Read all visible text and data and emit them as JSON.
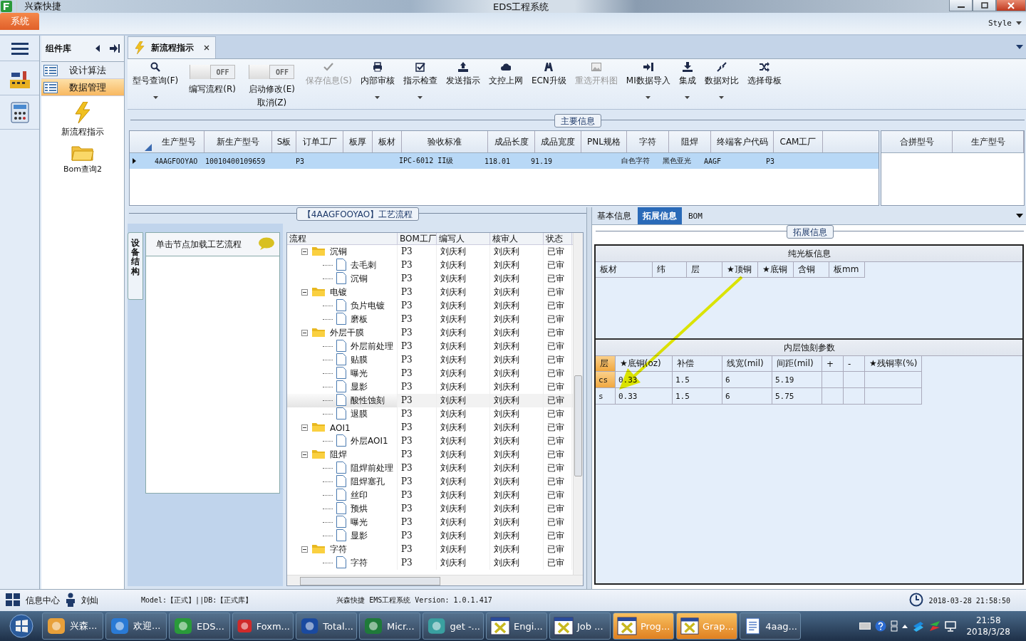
{
  "window": {
    "app_name": "兴森快捷",
    "title": "EDS工程系统"
  },
  "ribbon": {
    "tabs": [
      {
        "label": "系统",
        "selected": true
      }
    ],
    "style_menu": "Style"
  },
  "component_panel": {
    "title": "组件库",
    "items": [
      {
        "label": "设计算法",
        "selected": false
      },
      {
        "label": "数据管理",
        "selected": true
      }
    ],
    "tools": [
      {
        "label": "新流程指示"
      },
      {
        "label": "Bom查询2"
      }
    ]
  },
  "doc_tabs": [
    {
      "label": "新流程指示",
      "selected": true
    }
  ],
  "toolbar": [
    {
      "kind": "button",
      "lines": [
        "型号查询(F)"
      ],
      "disabled": false,
      "dropdown": true
    },
    {
      "kind": "toggle",
      "lines": [
        "编写流程(R)"
      ],
      "on": false,
      "state_text": "OFF"
    },
    {
      "kind": "toggle",
      "lines": [
        "启动修改(E)",
        "取消(Z)"
      ],
      "on": false,
      "state_text": "OFF"
    },
    {
      "kind": "button",
      "lines": [
        "保存信息(S)"
      ],
      "disabled": true,
      "dropdown": false
    },
    {
      "kind": "button",
      "lines": [
        "内部审核"
      ],
      "disabled": false,
      "dropdown": true
    },
    {
      "kind": "button",
      "lines": [
        "指示检查"
      ],
      "disabled": false,
      "dropdown": true
    },
    {
      "kind": "button",
      "lines": [
        "发送指示"
      ],
      "disabled": false,
      "dropdown": false
    },
    {
      "kind": "button",
      "lines": [
        "文控上网"
      ],
      "disabled": false,
      "dropdown": false
    },
    {
      "kind": "button",
      "lines": [
        "ECN升级"
      ],
      "disabled": false,
      "dropdown": false
    },
    {
      "kind": "button",
      "lines": [
        "重选开料图"
      ],
      "disabled": true,
      "dropdown": false
    },
    {
      "kind": "button",
      "lines": [
        "MI数据导入"
      ],
      "disabled": false,
      "dropdown": true
    },
    {
      "kind": "button",
      "lines": [
        "集成"
      ],
      "disabled": false,
      "dropdown": true
    },
    {
      "kind": "button",
      "lines": [
        "数据对比"
      ],
      "disabled": false,
      "dropdown": true
    },
    {
      "kind": "button",
      "lines": [
        "选择母板"
      ],
      "disabled": false,
      "dropdown": false
    }
  ],
  "main_info": {
    "title": "主要信息",
    "columns": [
      "生产型号",
      "新生产型号",
      "S板",
      "订单工厂",
      "板厚",
      "板材",
      "验收标准",
      "成品长度",
      "成品宽度",
      "PNL规格",
      "字符",
      "阻焊",
      "终端客户代码",
      "CAM工厂"
    ],
    "rows": [
      {
        "selected": true,
        "cells": [
          "4AAGFOOYAO",
          "10010400109659",
          "",
          "P3",
          "",
          "",
          "IPC-6012 II级",
          "118.01",
          "91.19",
          "",
          "白色字符",
          "黑色亚光",
          "AAGF",
          "P3"
        ]
      }
    ],
    "merge_columns": [
      "合拼型号",
      "生产型号"
    ]
  },
  "process": {
    "title": "【4AAGFOOYAO】工艺流程",
    "side_tab": "设备结构",
    "hint": "单击节点加载工艺流程",
    "columns": [
      "流程",
      "BOM工厂",
      "编写人",
      "核审人",
      "状态"
    ],
    "rows": [
      {
        "name": "沉铜",
        "factory": "P3",
        "writer": "刘庆利",
        "reviewer": "刘庆利",
        "status": "已审",
        "selected": false,
        "expanded": true,
        "children": [
          {
            "name": "去毛刺",
            "factory": "P3",
            "writer": "刘庆利",
            "reviewer": "刘庆利",
            "status": "已审",
            "selected": false
          },
          {
            "name": "沉铜",
            "factory": "P3",
            "writer": "刘庆利",
            "reviewer": "刘庆利",
            "status": "已审",
            "selected": false
          }
        ]
      },
      {
        "name": "电镀",
        "factory": "P3",
        "writer": "刘庆利",
        "reviewer": "刘庆利",
        "status": "已审",
        "selected": false,
        "expanded": true,
        "children": [
          {
            "name": "负片电镀",
            "factory": "P3",
            "writer": "刘庆利",
            "reviewer": "刘庆利",
            "status": "已审",
            "selected": false
          },
          {
            "name": "磨板",
            "factory": "P3",
            "writer": "刘庆利",
            "reviewer": "刘庆利",
            "status": "已审",
            "selected": false
          }
        ]
      },
      {
        "name": "外层干膜",
        "factory": "P3",
        "writer": "刘庆利",
        "reviewer": "刘庆利",
        "status": "已审",
        "selected": false,
        "expanded": true,
        "children": [
          {
            "name": "外层前处理",
            "factory": "P3",
            "writer": "刘庆利",
            "reviewer": "刘庆利",
            "status": "已审",
            "selected": false
          },
          {
            "name": "贴膜",
            "factory": "P3",
            "writer": "刘庆利",
            "reviewer": "刘庆利",
            "status": "已审",
            "selected": false
          },
          {
            "name": "曝光",
            "factory": "P3",
            "writer": "刘庆利",
            "reviewer": "刘庆利",
            "status": "已审",
            "selected": false
          },
          {
            "name": "显影",
            "factory": "P3",
            "writer": "刘庆利",
            "reviewer": "刘庆利",
            "status": "已审",
            "selected": false
          },
          {
            "name": "酸性蚀刻",
            "factory": "P3",
            "writer": "刘庆利",
            "reviewer": "刘庆利",
            "status": "已审",
            "selected": true
          },
          {
            "name": "退膜",
            "factory": "P3",
            "writer": "刘庆利",
            "reviewer": "刘庆利",
            "status": "已审",
            "selected": false
          }
        ]
      },
      {
        "name": "AOI1",
        "factory": "P3",
        "writer": "刘庆利",
        "reviewer": "刘庆利",
        "status": "已审",
        "selected": false,
        "expanded": true,
        "children": [
          {
            "name": "外层AOI1",
            "factory": "P3",
            "writer": "刘庆利",
            "reviewer": "刘庆利",
            "status": "已审",
            "selected": false
          }
        ]
      },
      {
        "name": "阻焊",
        "factory": "P3",
        "writer": "刘庆利",
        "reviewer": "刘庆利",
        "status": "已审",
        "selected": false,
        "expanded": true,
        "children": [
          {
            "name": "阻焊前处理",
            "factory": "P3",
            "writer": "刘庆利",
            "reviewer": "刘庆利",
            "status": "已审",
            "selected": false
          },
          {
            "name": "阻焊塞孔",
            "factory": "P3",
            "writer": "刘庆利",
            "reviewer": "刘庆利",
            "status": "已审",
            "selected": false
          },
          {
            "name": "丝印",
            "factory": "P3",
            "writer": "刘庆利",
            "reviewer": "刘庆利",
            "status": "已审",
            "selected": false
          },
          {
            "name": "预烘",
            "factory": "P3",
            "writer": "刘庆利",
            "reviewer": "刘庆利",
            "status": "已审",
            "selected": false
          },
          {
            "name": "曝光",
            "factory": "P3",
            "writer": "刘庆利",
            "reviewer": "刘庆利",
            "status": "已审",
            "selected": false
          },
          {
            "name": "显影",
            "factory": "P3",
            "writer": "刘庆利",
            "reviewer": "刘庆利",
            "status": "已审",
            "selected": false
          }
        ]
      },
      {
        "name": "字符",
        "factory": "P3",
        "writer": "刘庆利",
        "reviewer": "刘庆利",
        "status": "已审",
        "selected": false,
        "expanded": true,
        "children": [
          {
            "name": "字符",
            "factory": "P3",
            "writer": "刘庆利",
            "reviewer": "刘庆利",
            "status": "已审",
            "selected": false
          }
        ]
      }
    ]
  },
  "detail": {
    "tabs": [
      {
        "label": "基本信息",
        "selected": false
      },
      {
        "label": "拓展信息",
        "selected": true
      },
      {
        "label": "BOM",
        "selected": false
      }
    ],
    "group_title": "拓展信息",
    "bare_board": {
      "title": "纯光板信息",
      "columns": [
        "板材",
        "纬",
        "层",
        "★顶铜",
        "★底铜",
        "含铜",
        "板mm"
      ]
    },
    "inner_etch": {
      "title": "内层蚀刻参数",
      "columns": [
        "层",
        "★底铜(oz)",
        "补偿",
        "线宽(mil)",
        "间距(mil)",
        "+",
        "-",
        "★残铜率(%)"
      ],
      "rows": [
        {
          "selected": true,
          "cells": [
            "cs",
            "0.33",
            "1.5",
            "6",
            "5.19",
            "",
            "",
            ""
          ]
        },
        {
          "selected": false,
          "cells": [
            "s",
            "0.33",
            "1.5",
            "6",
            "5.75",
            "",
            "",
            ""
          ]
        }
      ]
    }
  },
  "status_bar": {
    "info_center": "信息中心",
    "user": "刘灿",
    "environment": "Model:【正式】||DB:【正式库】",
    "version": "兴森快捷 EMS工程系统 Version: 1.0.1.417",
    "datetime": "2018-03-28 21:58:50"
  },
  "taskbar": {
    "items": [
      {
        "label": "兴森...",
        "selected": false
      },
      {
        "label": "欢迎...",
        "selected": false
      },
      {
        "label": "EDS...",
        "selected": false
      },
      {
        "label": "Foxm...",
        "selected": false
      },
      {
        "label": "Total...",
        "selected": false
      },
      {
        "label": "Micr...",
        "selected": false
      },
      {
        "label": "get -...",
        "selected": false
      },
      {
        "label": "Engi...",
        "selected": false
      },
      {
        "label": "Job ...",
        "selected": false
      },
      {
        "label": "Prog...",
        "selected": true
      },
      {
        "label": "Grap...",
        "selected": true
      },
      {
        "label": "4aag...",
        "selected": false
      }
    ],
    "time": "21:58",
    "date": "2018/3/28"
  }
}
